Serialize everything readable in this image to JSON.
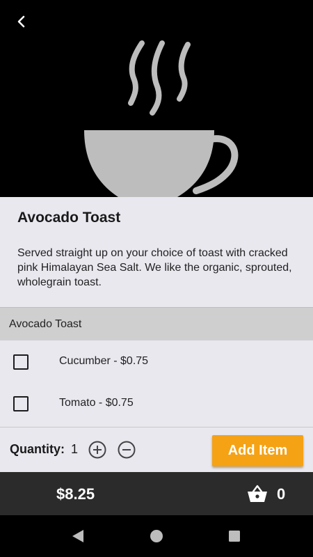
{
  "item": {
    "title": "Avocado Toast",
    "description": "Served straight up on your choice of toast with cracked pink Himalayan Sea Salt. We like the organic, sprouted, wholegrain toast."
  },
  "options_section": {
    "header": "Avocado Toast",
    "options": [
      {
        "label": "Cucumber - $0.75",
        "checked": false
      },
      {
        "label": "Tomato - $0.75",
        "checked": false
      }
    ]
  },
  "quantity": {
    "label": "Quantity:",
    "value": "1"
  },
  "add_button": {
    "label": "Add Item"
  },
  "footer": {
    "total": "$8.25",
    "cart_count": "0"
  },
  "icons": {
    "back": "chevron-left-icon",
    "hero": "coffee-cup-icon",
    "plus": "plus-circle-icon",
    "minus": "minus-circle-icon",
    "basket": "basket-icon",
    "nav_back": "triangle-back-icon",
    "nav_home": "circle-home-icon",
    "nav_recents": "square-recents-icon"
  },
  "colors": {
    "accent": "#f5a215",
    "content_bg": "#e9e8ef",
    "section_header_bg": "#cfcfcf",
    "footer_bg": "#2b2b2b",
    "hero_icon": "#bdbdbd"
  }
}
